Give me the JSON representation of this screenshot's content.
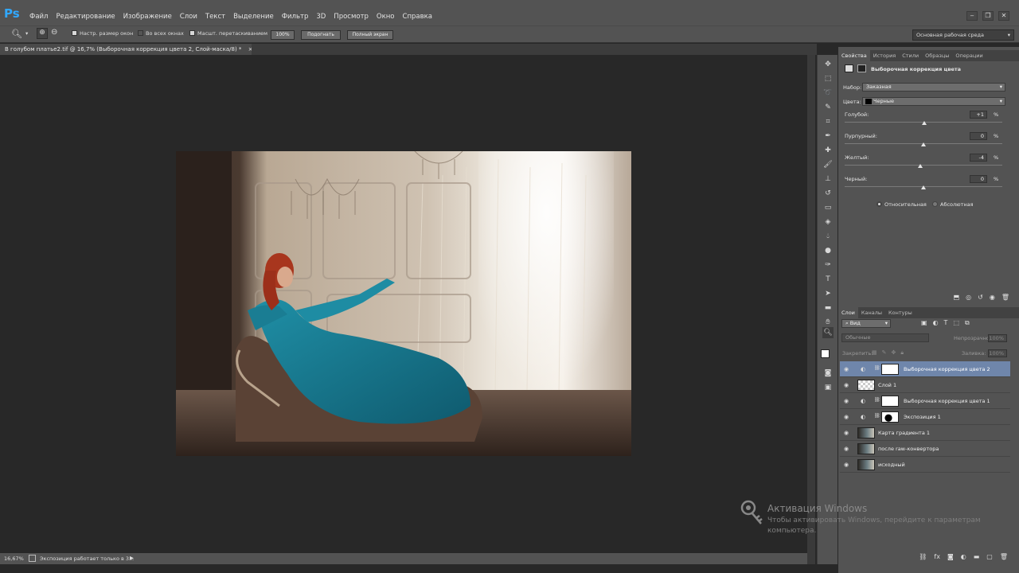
{
  "app": {
    "logo": "Ps"
  },
  "menu": [
    "Файл",
    "Редактирование",
    "Изображение",
    "Слои",
    "Текст",
    "Выделение",
    "Фильтр",
    "3D",
    "Просмотр",
    "Окно",
    "Справка"
  ],
  "options": {
    "fit_window": "Настр. размер окон",
    "all_windows": "Во всех окнах",
    "scrubby_zoom": "Масшт. перетаскиванием",
    "zoom_100": "100%",
    "fit_screen": "Подогнать",
    "full_screen": "Полный экран",
    "workspace": "Основная рабочая среда"
  },
  "document": {
    "tab_title": "В голубом платье2.tif @ 16,7% (Выборочная коррекция цвета 2, Слой-маска/8) *",
    "zoom": "16,67%",
    "status": "Экспозиция работает только в 3..."
  },
  "properties": {
    "tabs": [
      "Свойства",
      "История",
      "Стили",
      "Образцы",
      "Операции"
    ],
    "header": "Выборочная коррекция цвета",
    "preset_label": "Набор:",
    "preset_value": "Заказная",
    "colors_label": "Цвета:",
    "colors_value": "Черные",
    "sliders": [
      {
        "label": "Голубой:",
        "value": "+1",
        "unit": "%",
        "pos": 0.505
      },
      {
        "label": "Пурпурный:",
        "value": "0",
        "unit": "%",
        "pos": 0.5
      },
      {
        "label": "Желтый:",
        "value": "-4",
        "unit": "%",
        "pos": 0.48
      },
      {
        "label": "Черный:",
        "value": "0",
        "unit": "%",
        "pos": 0.5
      }
    ],
    "mode_relative": "Относительная",
    "mode_absolute": "Абсолютная"
  },
  "layers_panel": {
    "tabs": [
      "Слои",
      "Каналы",
      "Контуры"
    ],
    "filter": "Вид",
    "blend_mode": "Обычные",
    "opacity_label": "Непрозрачность:",
    "opacity_value": "100%",
    "lock_label": "Закрепить:",
    "fill_label": "Заливка:",
    "fill_value": "100%",
    "layers": [
      {
        "name": "Выборочная коррекция цвета 2",
        "selected": true,
        "adjust": true,
        "thumb": "white"
      },
      {
        "name": "Слой 1",
        "selected": false,
        "adjust": false,
        "thumb": "checker"
      },
      {
        "name": "Выборочная коррекция цвета 1",
        "selected": false,
        "adjust": true,
        "thumb": "white"
      },
      {
        "name": "Экспозиция 1",
        "selected": false,
        "adjust": true,
        "thumb": "mask"
      },
      {
        "name": "Карта градиента 1",
        "selected": false,
        "adjust": false,
        "thumb": "photo"
      },
      {
        "name": "после raw-конвертора",
        "selected": false,
        "adjust": false,
        "thumb": "photo"
      },
      {
        "name": "исходный",
        "selected": false,
        "adjust": false,
        "thumb": "photo"
      }
    ]
  },
  "watermark": {
    "title": "Активация Windows",
    "text": "Чтобы активировать Windows, перейдите к параметрам компьютера."
  }
}
